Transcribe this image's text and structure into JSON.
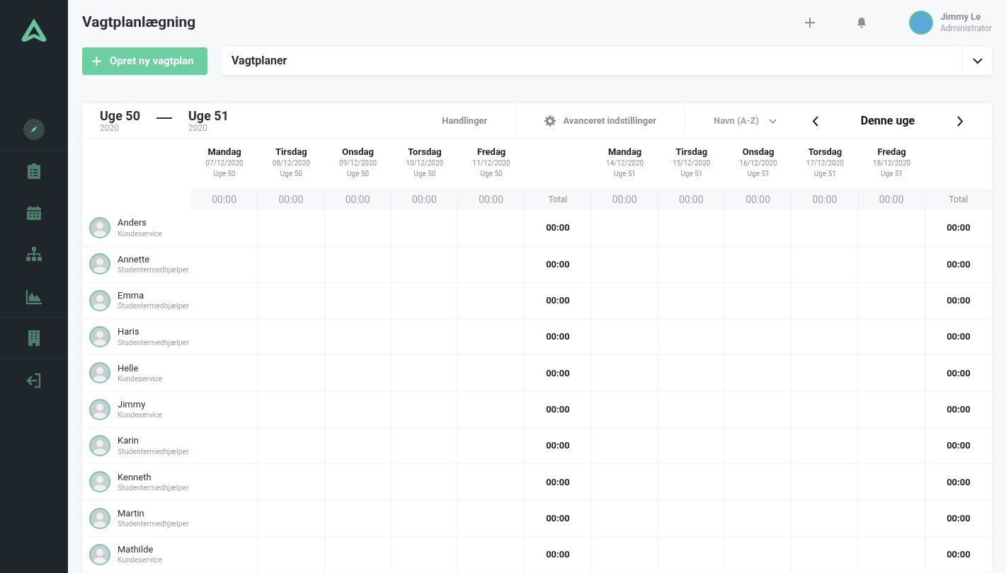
{
  "sidebar": {
    "items": [
      {
        "kind": "compass",
        "selected": true
      },
      {
        "kind": "clipboard",
        "selected": false
      },
      {
        "kind": "calendar",
        "selected": false
      },
      {
        "kind": "org",
        "selected": false
      },
      {
        "kind": "chart",
        "selected": false
      },
      {
        "kind": "building",
        "selected": false
      },
      {
        "kind": "logout",
        "selected": false
      }
    ]
  },
  "header": {
    "title": "Vagtplanlægning",
    "user": {
      "name": "Jimmy Le",
      "role": "Administrator"
    }
  },
  "toolbar": {
    "create_button": "Opret ny vagtplan",
    "plans_dropdown": "Vagtplaner"
  },
  "schedule": {
    "range": [
      {
        "week": "Uge 50",
        "year": "2020"
      },
      {
        "week": "Uge 51",
        "year": "2020"
      }
    ],
    "actions": "Handlinger",
    "advanced": "Avanceret indstillinger",
    "sort": "Navn (A-Z)",
    "current": "Denne uge",
    "weeks": [
      {
        "total_label": "Total",
        "days": [
          {
            "day": "Mandag",
            "date": "07/12/2020",
            "week": "Uge 50",
            "hours": "00:00"
          },
          {
            "day": "Tirsdag",
            "date": "08/12/2020",
            "week": "Uge 50",
            "hours": "00:00"
          },
          {
            "day": "Onsdag",
            "date": "09/12/2020",
            "week": "Uge 50",
            "hours": "00:00"
          },
          {
            "day": "Torsdag",
            "date": "10/12/2020",
            "week": "Uge 50",
            "hours": "00:00"
          },
          {
            "day": "Fredag",
            "date": "11/12/2020",
            "week": "Uge 50",
            "hours": "00:00"
          }
        ]
      },
      {
        "total_label": "Total",
        "days": [
          {
            "day": "Mandag",
            "date": "14/12/2020",
            "week": "Uge 51",
            "hours": "00:00"
          },
          {
            "day": "Tirsdag",
            "date": "15/12/2020",
            "week": "Uge 51",
            "hours": "00:00"
          },
          {
            "day": "Onsdag",
            "date": "16/12/2020",
            "week": "Uge 51",
            "hours": "00:00"
          },
          {
            "day": "Torsdag",
            "date": "17/12/2020",
            "week": "Uge 51",
            "hours": "00:00"
          },
          {
            "day": "Fredag",
            "date": "18/12/2020",
            "week": "Uge 51",
            "hours": "00:00"
          }
        ]
      }
    ],
    "employees": [
      {
        "name": "Anders",
        "role": "Kundeservice",
        "totals": [
          "00:00",
          "00:00"
        ]
      },
      {
        "name": "Annette",
        "role": "Studentermedhjælper",
        "totals": [
          "00:00",
          "00:00"
        ]
      },
      {
        "name": "Emma",
        "role": "Studentermedhjælper",
        "totals": [
          "00:00",
          "00:00"
        ]
      },
      {
        "name": "Haris",
        "role": "Studentermedhjælper",
        "totals": [
          "00:00",
          "00:00"
        ]
      },
      {
        "name": "Helle",
        "role": "Kundeservice",
        "totals": [
          "00:00",
          "00:00"
        ]
      },
      {
        "name": "Jimmy",
        "role": "Kundeservice",
        "totals": [
          "00:00",
          "00:00"
        ]
      },
      {
        "name": "Karin",
        "role": "Studentermedhjælper",
        "totals": [
          "00:00",
          "00:00"
        ]
      },
      {
        "name": "Kenneth",
        "role": "Studentermedhjælper",
        "totals": [
          "00:00",
          "00:00"
        ]
      },
      {
        "name": "Martin",
        "role": "Studentermedhjælper",
        "totals": [
          "00:00",
          "00:00"
        ]
      },
      {
        "name": "Mathilde",
        "role": "Kundeservice",
        "totals": [
          "00:00",
          "00:00"
        ]
      }
    ]
  }
}
